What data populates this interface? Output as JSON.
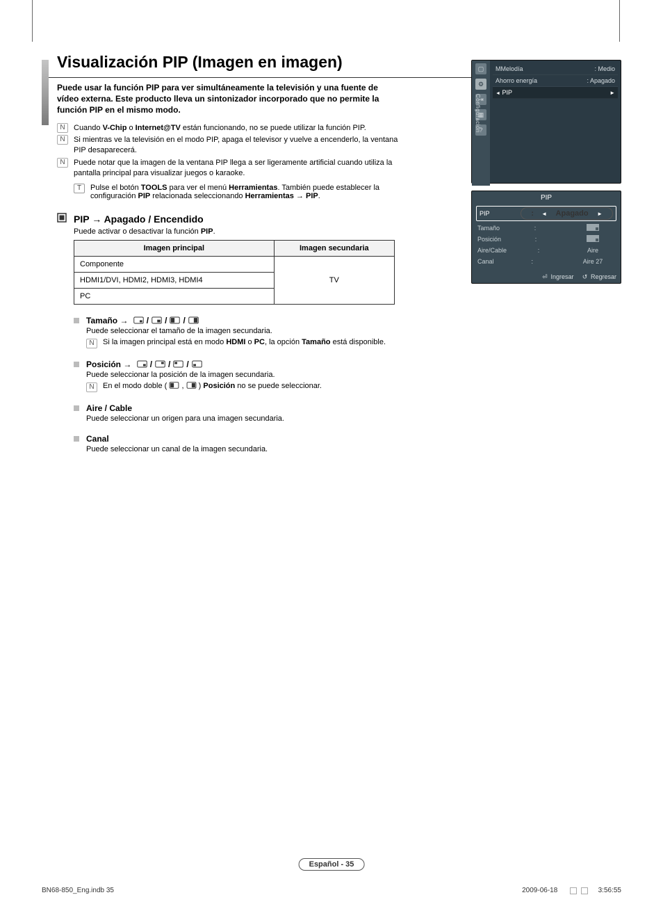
{
  "title": "Visualización PIP (Imagen en imagen)",
  "intro": "Puede usar la función PIP para ver simultáneamente la televisión y una fuente de vídeo externa. Este producto lleva un sintonizador incorporado que no permite la función PIP en el mismo modo.",
  "notes": {
    "n1_pre": "Cuando ",
    "n1_b1": "V-Chip",
    "n1_mid": " o ",
    "n1_b2": "Internet@TV",
    "n1_post": " están funcionando, no se puede utilizar la función PIP.",
    "n2": "Si mientras ve la televisión en el modo PIP, apaga el televisor y vuelve a encenderlo, la ventana PIP desaparecerá.",
    "n3": "Puede notar que la imagen de la ventana PIP llega a ser ligeramente artificial cuando utiliza la pantalla principal para visualizar juegos o karaoke."
  },
  "tools": {
    "pre": "Pulse el botón ",
    "b1": "TOOLS",
    "mid": " para ver el menú ",
    "b2": "Herramientas",
    "post1": ". También puede establecer la configuración ",
    "b3": "PIP",
    "post2": " relacionada seleccionando ",
    "b4": "Herramientas → PIP",
    "end": "."
  },
  "section_pip": {
    "head": "PIP → Apagado / Encendido",
    "body_pre": "Puede activar o desactivar la función ",
    "body_b": "PIP",
    "body_post": "."
  },
  "table": {
    "h1": "Imagen principal",
    "h2": "Imagen secundaria",
    "r1": "Componente",
    "r2": "HDMI1/DVI, HDMI2, HDMI3, HDMI4",
    "r3": "PC",
    "val": "TV"
  },
  "sub_tamano": {
    "head": "Tamaño →",
    "body": "Puede seleccionar el tamaño de la imagen secundaria.",
    "note_pre": "Si la imagen principal está en modo ",
    "note_b1": "HDMI",
    "note_mid": " o ",
    "note_b2": "PC",
    "note_mid2": ", la opción ",
    "note_b3": "Tamaño",
    "note_post": " está disponible."
  },
  "sub_posicion": {
    "head": "Posición →",
    "body": "Puede seleccionar la posición de la imagen secundaria.",
    "note_pre": "En el modo doble (",
    "note_mid": " , ",
    "note_post": ") ",
    "note_b": "Posición",
    "note_end": " no se puede seleccionar."
  },
  "sub_aire": {
    "head": "Aire / Cable",
    "body": "Puede seleccionar un origen para una imagen secundaria."
  },
  "sub_canal": {
    "head": "Canal",
    "body": "Puede seleccionar un canal de la imagen secundaria."
  },
  "tv1": {
    "tab": "Configuración",
    "r1l": "MMelodía",
    "r1v": ": Medio",
    "r2l": "Ahorro energía",
    "r2v": ": Apagado",
    "r3l": "PIP"
  },
  "tv2": {
    "title": "PIP",
    "r1l": "PIP",
    "r1v": "Apagado",
    "r2l": "Tamaño",
    "r3l": "Posición",
    "r4l": "Aire/Cable",
    "r4v": "Aire",
    "r5l": "Canal",
    "r5v": "Aire 27",
    "f1": "Ingresar",
    "f2": "Regresar"
  },
  "footer": {
    "page": "Español - 35",
    "file": "BN68-850_Eng.indb   35",
    "date": "2009-06-18",
    "time": "3:56:55"
  }
}
